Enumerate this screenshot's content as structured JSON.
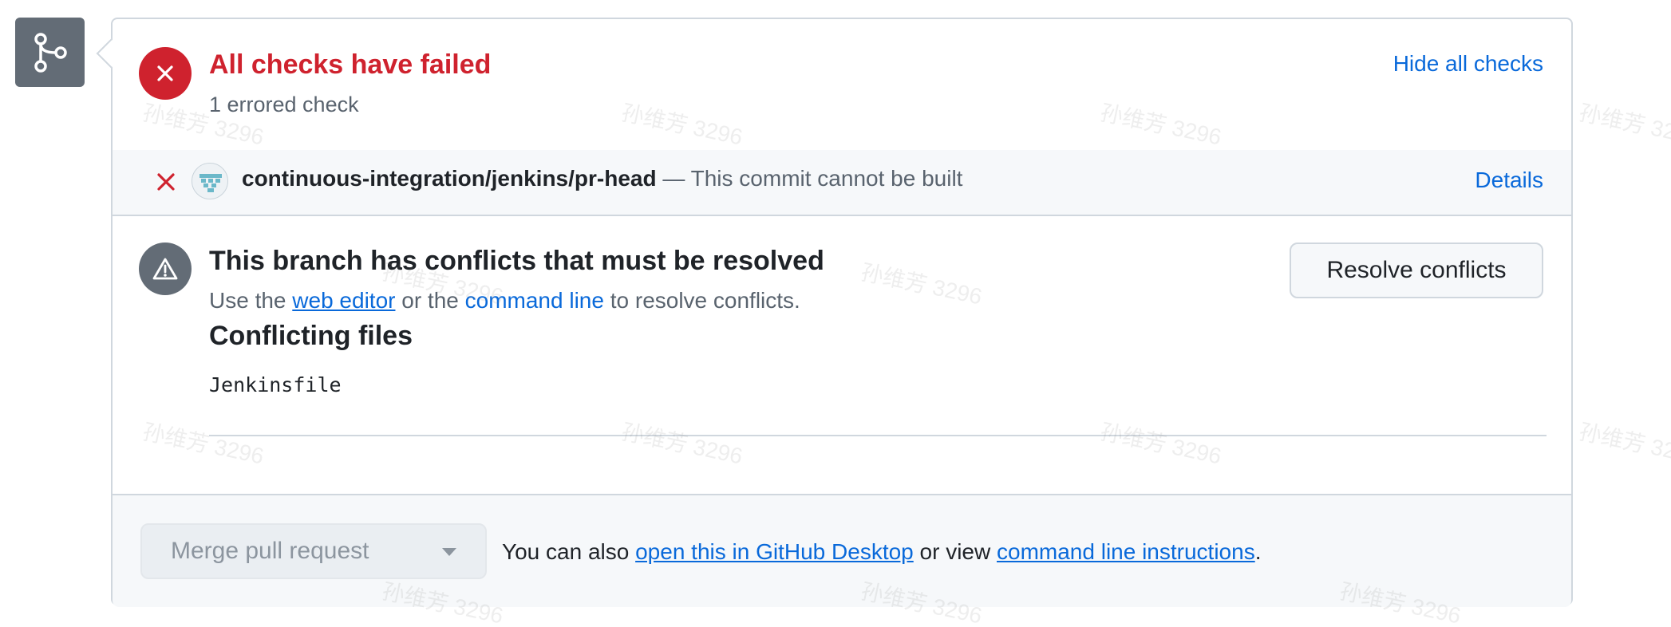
{
  "checks": {
    "title": "All checks have failed",
    "subtitle": "1 errored check",
    "hide_link": "Hide all checks",
    "items": [
      {
        "name": "continuous-integration/jenkins/pr-head",
        "description": " — This commit cannot be built",
        "details_link": "Details",
        "status": "error"
      }
    ]
  },
  "conflicts": {
    "title": "This branch has conflicts that must be resolved",
    "desc_prefix": "Use the ",
    "web_editor_link": "web editor",
    "desc_middle": " or the ",
    "command_line_link": "command line",
    "desc_suffix": " to resolve conflicts.",
    "resolve_button": "Resolve conflicts",
    "files_title": "Conflicting files",
    "files": [
      "Jenkinsfile"
    ]
  },
  "footer": {
    "merge_button": "Merge pull request",
    "text_prefix": "You can also ",
    "desktop_link": "open this in GitHub Desktop",
    "text_middle": " or view ",
    "instructions_link": "command line instructions",
    "text_suffix": "."
  },
  "watermark": "孙维芳 3296",
  "colors": {
    "error": "#cf222e",
    "link": "#0969da",
    "muted": "#59636e",
    "icon_bg": "#636c76",
    "border": "#d0d7de"
  }
}
